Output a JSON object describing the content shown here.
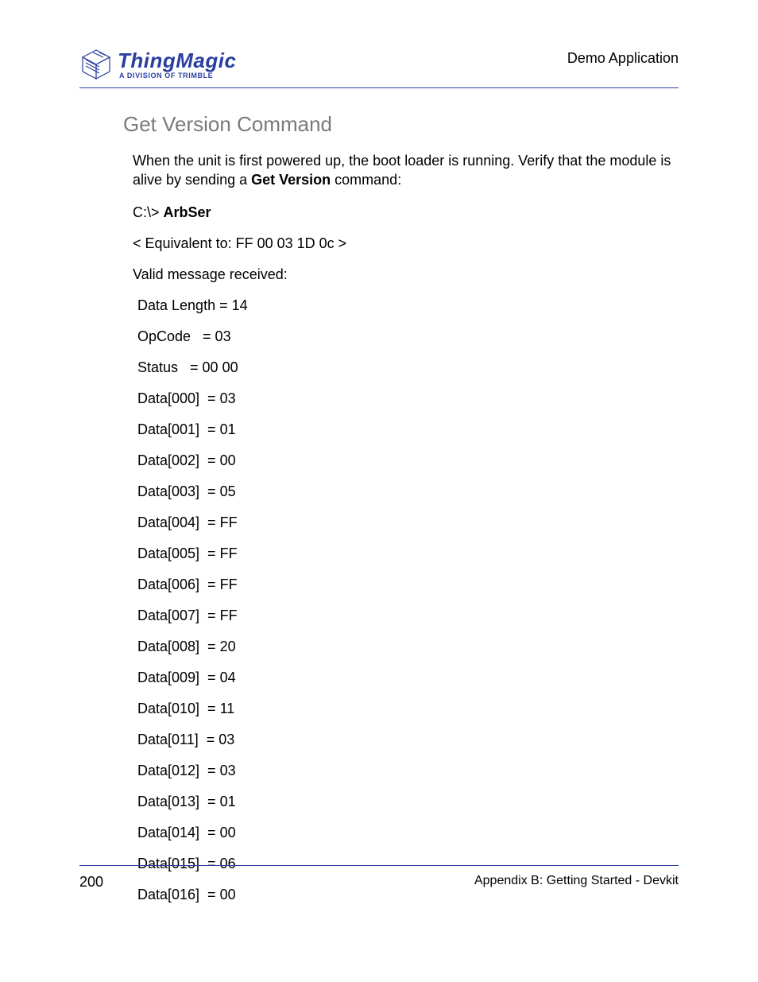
{
  "header": {
    "brand": "ThingMagic",
    "tagline": "A DIVISION OF TRIMBLE",
    "top_right": "Demo Application"
  },
  "section": {
    "title": "Get Version Command",
    "intro_before_bold": "When the unit is first powered up, the boot loader is running. Verify that the module is alive by sending a ",
    "intro_bold": "Get Version",
    "intro_after_bold": " command:",
    "prompt_prefix": "C:\\> ",
    "prompt_cmd": "ArbSer",
    "equivalent": "< Equivalent to: FF 00 03 1D 0c >",
    "valid_msg": "Valid message received:",
    "rows": [
      "Data Length = 14",
      "OpCode   = 03",
      "Status   = 00 00",
      "Data[000]  = 03",
      "Data[001]  = 01",
      "Data[002]  = 00",
      "Data[003]  = 05",
      "Data[004]  = FF",
      "Data[005]  = FF",
      "Data[006]  = FF",
      "Data[007]  = FF",
      "Data[008]  = 20",
      "Data[009]  = 04",
      "Data[010]  = 11",
      "Data[011]  = 03",
      "Data[012]  = 03",
      "Data[013]  = 01",
      "Data[014]  = 00",
      "Data[015]  = 06",
      "Data[016]  = 00"
    ]
  },
  "footer": {
    "page": "200",
    "appendix": "Appendix B: Getting Started - Devkit"
  }
}
